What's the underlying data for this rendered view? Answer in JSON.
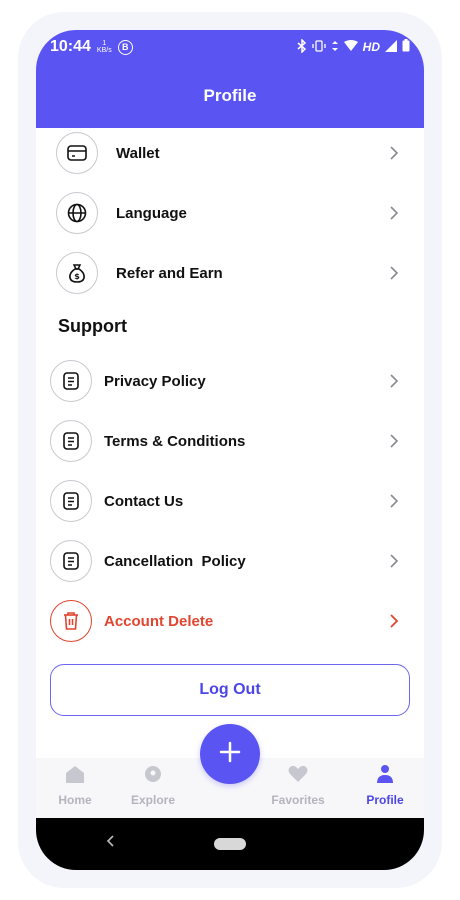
{
  "status_bar": {
    "time": "10:44",
    "net_speed_value": "1",
    "net_speed_unit": "KB/s",
    "badge": "B",
    "network_label": "HD"
  },
  "header": {
    "title": "Profile"
  },
  "menu_top": [
    {
      "label": "Wallet",
      "icon": "wallet-icon"
    },
    {
      "label": "Language",
      "icon": "globe-icon"
    },
    {
      "label": "Refer and Earn",
      "icon": "money-bag-icon"
    }
  ],
  "support": {
    "title": "Support",
    "items": [
      {
        "label": "Privacy Policy",
        "icon": "document-icon"
      },
      {
        "label": "Terms & Conditions",
        "icon": "document-icon"
      },
      {
        "label": "Contact Us",
        "icon": "document-icon"
      },
      {
        "label": "Cancellation  Policy",
        "icon": "document-icon"
      }
    ]
  },
  "account_delete": {
    "label": "Account Delete",
    "icon": "trash-icon",
    "color": "#e0452f"
  },
  "logout": {
    "label": "Log Out"
  },
  "bottom_nav": {
    "items": [
      {
        "label": "Home",
        "icon": "home-icon"
      },
      {
        "label": "Explore",
        "icon": "location-pin-icon"
      },
      {
        "label": "Favorites",
        "icon": "heart-icon"
      },
      {
        "label": "Profile",
        "icon": "person-icon",
        "active": true
      }
    ],
    "fab_icon": "plus-icon"
  },
  "colors": {
    "primary": "#5a54f3",
    "danger": "#e0452f",
    "inactive": "#b4b4bf"
  }
}
